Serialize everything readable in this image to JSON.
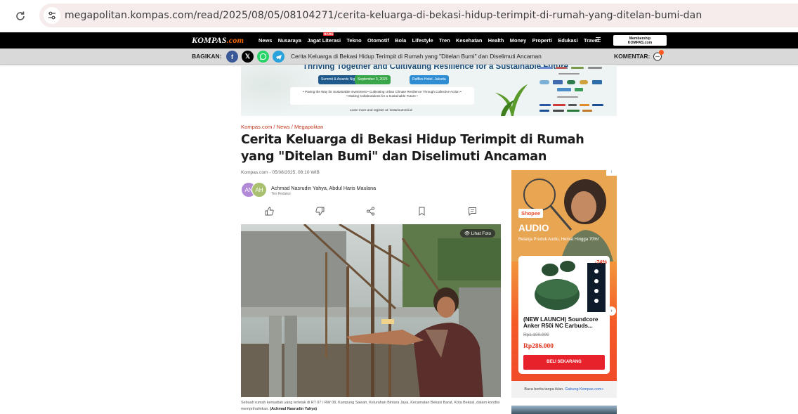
{
  "browser": {
    "url": "megapolitan.kompas.com/read/2025/08/05/08104271/cerita-keluarga-di-bekasi-hidup-terimpit-di-rumah-yang-ditelan-bumi-dan"
  },
  "topnav": {
    "logo_text": "KOMPAS",
    "logo_suffix": ".com",
    "items": [
      "News",
      "Nusaraya",
      "Jagat Literasi",
      "Tekno",
      "Otomotif",
      "Bola",
      "Lifestyle",
      "Tren",
      "Kesehatan",
      "Health",
      "Money",
      "Properti",
      "Edukasi",
      "Travel"
    ],
    "new_badge": "BARU",
    "member_line1": "Membership",
    "member_line2": "KOMPAS.com"
  },
  "sharebar": {
    "label": "BAGIKAN:",
    "headline": "Cerita Keluarga di Bekasi Hidup Terimpit di Rumah yang \"Ditelan Bumi\" dan Diselimuti Ancaman",
    "comment_label": "KOMENTAR:",
    "socials": [
      "facebook-icon",
      "x-icon",
      "whatsapp-icon",
      "telegram-icon"
    ]
  },
  "top_ad": {
    "headline": "Thriving Together and Cultivating Resilience for a Sustainable Future",
    "pill1": "Summit & Awards Night",
    "pill2": "September 3, 2025",
    "pill3": "Raffles Hotel, Jakarta",
    "line1": "• Paving the Way for Sustainable Investment • Cultivating Urban Climate Resilience Through Collective Action •",
    "line2": "• Making Collaborations for a Sustainable Future •",
    "learn": "Learn more and register at: lestarisummit.id"
  },
  "article": {
    "breadcrumb": "Kompas.com / News / Megapolitan",
    "title": "Cerita Keluarga di Bekasi Hidup Terimpit di Rumah yang \"Ditelan Bumi\" dan Diselimuti Ancaman",
    "meta": "Kompas.com - 05/08/2025, 08:10 WIB",
    "avatar1": "AN",
    "avatar2": "AH",
    "authors": "Achmad Nasrudin Yahya,  Abdul Haris Maulana",
    "editor": "Tim Redaksi",
    "photo_button": "Lihat Foto",
    "caption": "Sebuah rumah kemudian yang terletak di RT 07 / RW 08, Kampung Sawah, Kelurahan Bintara Jaya, Kecamatan Bekasi Barat, Kota Bekasi, dalam kondisi memprihatinkan.",
    "caption_credit": "(Achmad Nasrudin Yahya)"
  },
  "side_ad": {
    "brand": "Shopee",
    "category": "AUDIO",
    "subtitle": "Belanja Produk Audio, Hemat Hingga 70%!",
    "discount": "-74%",
    "product_name": "(NEW LAUNCH) Soundcore Anker R50i NC Earbuds...",
    "old_price": "Rp1.100.000",
    "price": "Rp286.000",
    "buy_label": "BELI SEKARANG",
    "ad_marker": "i",
    "read_more": "Baca berita tanpa iklan.",
    "read_more_link": "Gabung Kompas.com+"
  }
}
